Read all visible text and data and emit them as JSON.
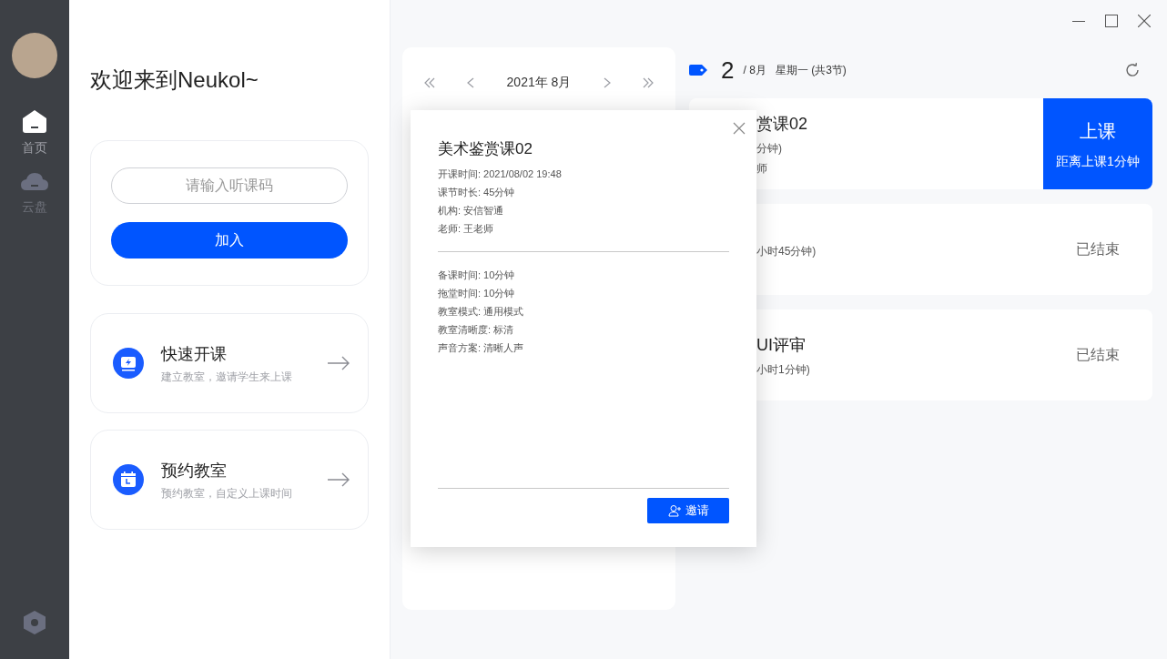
{
  "sidebar": {
    "items": [
      {
        "label": "首页",
        "kind": "home",
        "selected": true
      },
      {
        "label": "云盘",
        "kind": "cloud",
        "selected": false
      }
    ]
  },
  "welcome": "欢迎来到Neukol~",
  "join": {
    "placeholder": "请输入听课码",
    "button": "加入"
  },
  "actions": [
    {
      "kind": "quick",
      "title": "快速开课",
      "subtitle": "建立教室，邀请学生来上课"
    },
    {
      "kind": "book",
      "title": "预约教室",
      "subtitle": "预约教室，自定义上课时间"
    }
  ],
  "calendar": {
    "month": "2021年 8月"
  },
  "day": {
    "number": "2",
    "month": "/ 8月",
    "weekday": "星期一 (共3节)"
  },
  "courses": [
    {
      "lines": [
        "赏课02",
        "分钟)",
        "师"
      ],
      "kind": "upcoming",
      "action": "上课",
      "note": "距离上课1分钟"
    },
    {
      "lines": [
        "小时45分钟)"
      ],
      "kind": "ended",
      "action": "已结束"
    },
    {
      "lines": [
        "UI评审",
        "小时1分钟)"
      ],
      "kind": "ended",
      "action": "已结束"
    }
  ],
  "dialog": {
    "title": "美术鉴赏课02",
    "info": [
      "开课时间: 2021/08/02 19:48",
      "课节时长: 45分钟",
      "机构: 安信智通",
      "老师: 王老师"
    ],
    "settings": [
      "备课时间: 10分钟",
      "拖堂时间: 10分钟",
      "教室模式: 通用模式",
      "教室清晰度: 标清",
      "声音方案: 清晰人声"
    ],
    "button": "邀请"
  }
}
